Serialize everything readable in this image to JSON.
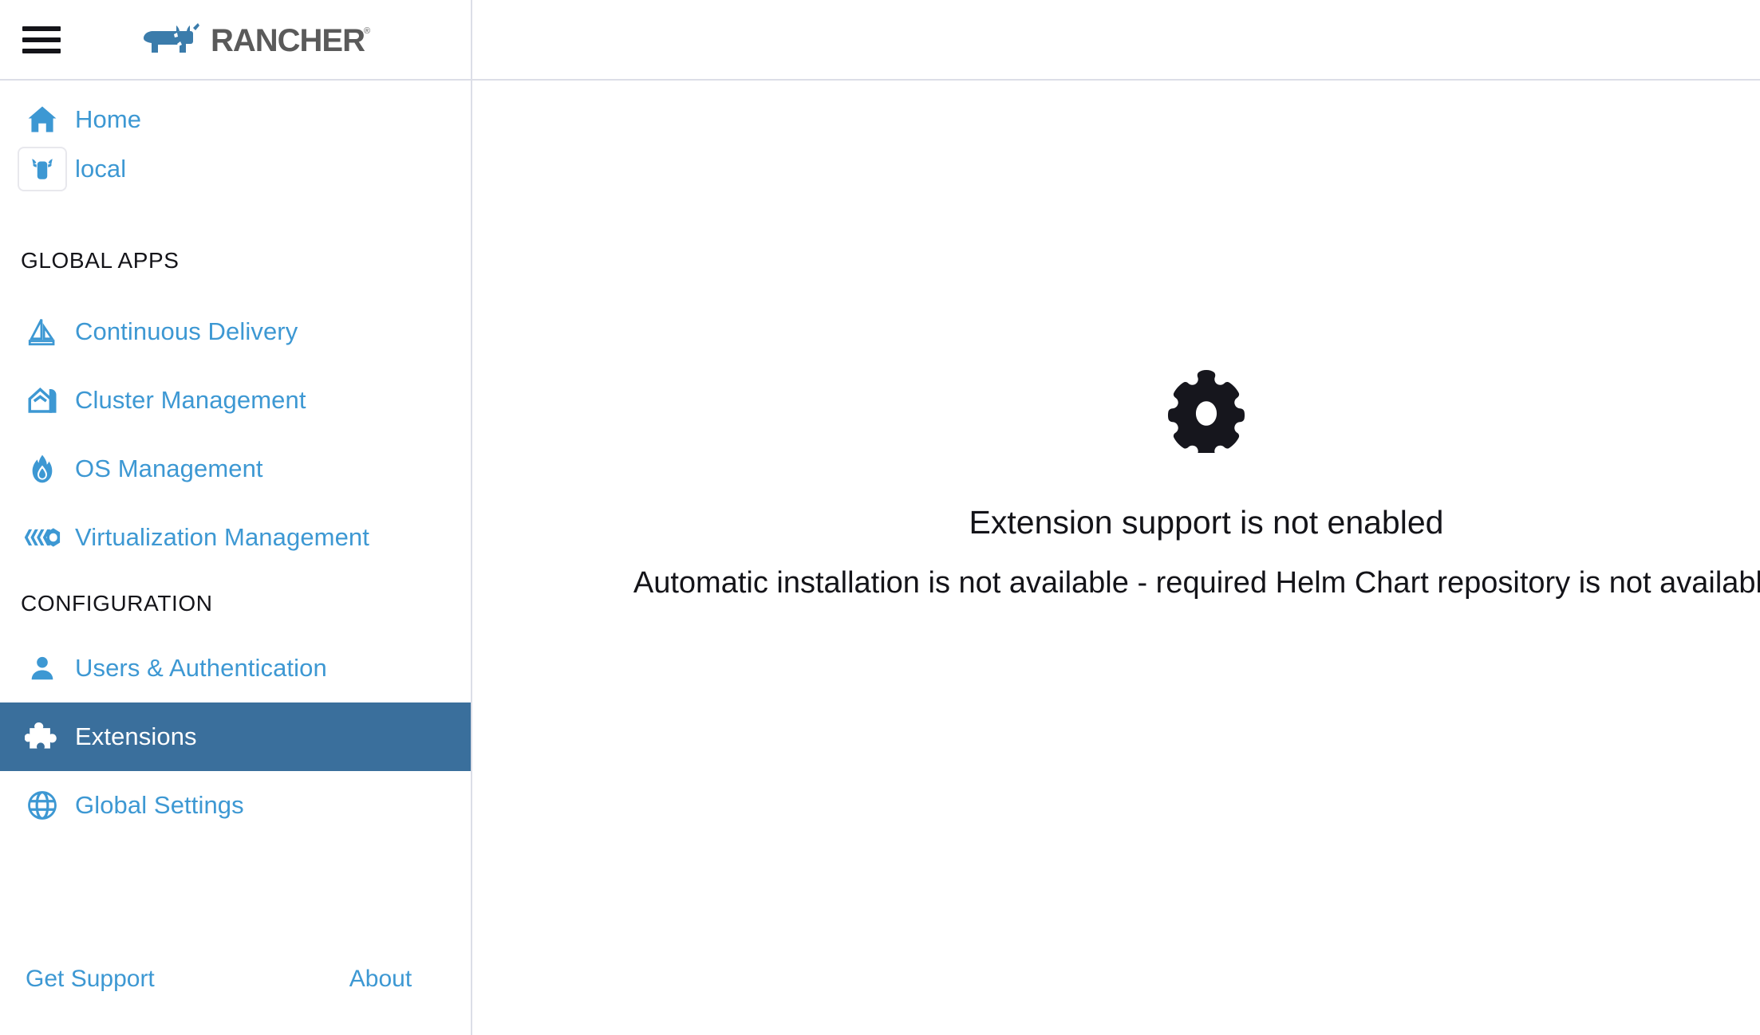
{
  "header": {
    "menu_toggle_name": "Menu",
    "brand": "RANCHER",
    "brand_trademark": "®"
  },
  "sidebar": {
    "top_items": [
      {
        "label": "Home",
        "icon": "home-icon",
        "id": "home"
      },
      {
        "label": "local",
        "icon": "cluster-cow-icon",
        "id": "local"
      }
    ],
    "groups": [
      {
        "title": "GLOBAL APPS",
        "items": [
          {
            "label": "Continuous Delivery",
            "icon": "sailboat-icon",
            "id": "continuous-delivery"
          },
          {
            "label": "Cluster Management",
            "icon": "barn-icon",
            "id": "cluster-management"
          },
          {
            "label": "OS Management",
            "icon": "flame-drop-icon",
            "id": "os-management"
          },
          {
            "label": "Virtualization Management",
            "icon": "harvester-icon",
            "id": "virtualization-management"
          }
        ]
      },
      {
        "title": "CONFIGURATION",
        "items": [
          {
            "label": "Users & Authentication",
            "icon": "user-icon",
            "id": "users-authentication",
            "active": false
          },
          {
            "label": "Extensions",
            "icon": "puzzle-piece-icon",
            "id": "extensions",
            "active": true
          },
          {
            "label": "Global Settings",
            "icon": "globe-icon",
            "id": "global-settings",
            "active": false
          }
        ]
      }
    ],
    "footer": {
      "support": "Get Support",
      "about": "About"
    }
  },
  "main": {
    "icon": "gear-icon",
    "title": "Extension support is not enabled",
    "subtitle": "Automatic installation is not available - required Helm Chart repository is not available"
  },
  "colors": {
    "link_blue": "#3d98d3",
    "active_bg": "#3a6f9c",
    "brand_blue": "#3b7cab",
    "brand_gray": "#5a5a5a",
    "text_dark": "#141419",
    "border": "#dcdee7"
  }
}
